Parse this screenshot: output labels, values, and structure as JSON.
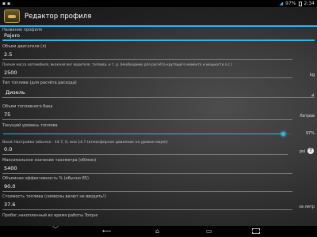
{
  "status": {
    "time": "2:34",
    "battery": "97%"
  },
  "header": {
    "title": "Редактор профиля"
  },
  "fields": {
    "profile_name": {
      "label": "Название профиля",
      "value": "Pajero"
    },
    "engine_size": {
      "label": "Объем двигателя (л)",
      "value": "2.5"
    },
    "vehicle_mass": {
      "label": "Полная масса автомобиля, включая вес водителя, топлива, и т. д. (Необходимо для расчёта крутящего момента и мощности л.с.)",
      "value": "2500",
      "unit": "kg"
    },
    "fuel_type": {
      "label": "Тип топлива (для расчёта расхода)",
      "value": "Дизель"
    },
    "tank_volume": {
      "label": "Объем топливного бака",
      "value": "75",
      "unit": "Литров"
    },
    "fuel_level": {
      "label": "Текущий уровень топлива",
      "value": "97%",
      "fraction": 0.97
    },
    "boost": {
      "label": "Boost Настройка (обычно - 14.7, 0, или 14.7 (атмосферное давление на уровне моря))",
      "value": "0.0",
      "unit": "psi"
    },
    "max_rpm": {
      "label": "Максимальное значение тахометра (об/мин)",
      "value": "5400"
    },
    "vol_efficiency": {
      "label": "Объемная эффективность % (обычно 85)",
      "value": "90.0"
    },
    "fuel_cost": {
      "label": "Стоимость топлива (символы валют не вводить!)",
      "value": "37.6",
      "unit": "за литр"
    },
    "mileage": {
      "label": "Пробег,накопленный во время работы Torque"
    }
  },
  "icons": {
    "help": "?"
  },
  "colors": {
    "accent": "#33b5e5"
  }
}
